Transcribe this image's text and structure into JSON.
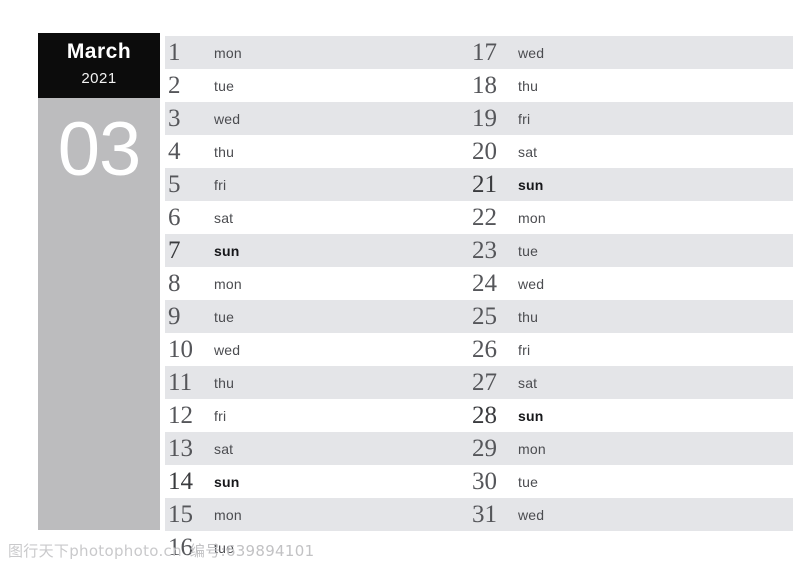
{
  "header": {
    "month_name": "March",
    "year": "2021",
    "month_number": "03"
  },
  "colors": {
    "header_background": "#0c0c0c",
    "sidebar_background": "#bcbcbe",
    "stripe_shade": "#e4e5e8",
    "stripe_blank": "#ffffff",
    "page_background": "#ffffff",
    "number_text": "#55565a",
    "weekday_text": "#4b4c50",
    "highlight_text": "#16171a",
    "watermark_text": "#c9c9cb"
  },
  "calendar": {
    "left_column": [
      {
        "date": "1",
        "weekday": "mon",
        "highlight": false,
        "shaded": true
      },
      {
        "date": "2",
        "weekday": "tue",
        "highlight": false,
        "shaded": false
      },
      {
        "date": "3",
        "weekday": "wed",
        "highlight": false,
        "shaded": true
      },
      {
        "date": "4",
        "weekday": "thu",
        "highlight": false,
        "shaded": false
      },
      {
        "date": "5",
        "weekday": "fri",
        "highlight": false,
        "shaded": true
      },
      {
        "date": "6",
        "weekday": "sat",
        "highlight": false,
        "shaded": false
      },
      {
        "date": "7",
        "weekday": "sun",
        "highlight": true,
        "shaded": true
      },
      {
        "date": "8",
        "weekday": "mon",
        "highlight": false,
        "shaded": false
      },
      {
        "date": "9",
        "weekday": "tue",
        "highlight": false,
        "shaded": true
      },
      {
        "date": "10",
        "weekday": "wed",
        "highlight": false,
        "shaded": false
      },
      {
        "date": "11",
        "weekday": "thu",
        "highlight": false,
        "shaded": true
      },
      {
        "date": "12",
        "weekday": "fri",
        "highlight": false,
        "shaded": false
      },
      {
        "date": "13",
        "weekday": "sat",
        "highlight": false,
        "shaded": true
      },
      {
        "date": "14",
        "weekday": "sun",
        "highlight": true,
        "shaded": false
      },
      {
        "date": "15",
        "weekday": "mon",
        "highlight": false,
        "shaded": true
      },
      {
        "date": "16",
        "weekday": "tue",
        "highlight": false,
        "shaded": false
      }
    ],
    "right_column": [
      {
        "date": "17",
        "weekday": "wed",
        "highlight": false,
        "shaded": true
      },
      {
        "date": "18",
        "weekday": "thu",
        "highlight": false,
        "shaded": false
      },
      {
        "date": "19",
        "weekday": "fri",
        "highlight": false,
        "shaded": true
      },
      {
        "date": "20",
        "weekday": "sat",
        "highlight": false,
        "shaded": false
      },
      {
        "date": "21",
        "weekday": "sun",
        "highlight": true,
        "shaded": true
      },
      {
        "date": "22",
        "weekday": "mon",
        "highlight": false,
        "shaded": false
      },
      {
        "date": "23",
        "weekday": "tue",
        "highlight": false,
        "shaded": true
      },
      {
        "date": "24",
        "weekday": "wed",
        "highlight": false,
        "shaded": false
      },
      {
        "date": "25",
        "weekday": "thu",
        "highlight": false,
        "shaded": true
      },
      {
        "date": "26",
        "weekday": "fri",
        "highlight": false,
        "shaded": false
      },
      {
        "date": "27",
        "weekday": "sat",
        "highlight": false,
        "shaded": true
      },
      {
        "date": "28",
        "weekday": "sun",
        "highlight": true,
        "shaded": false
      },
      {
        "date": "29",
        "weekday": "mon",
        "highlight": false,
        "shaded": true
      },
      {
        "date": "30",
        "weekday": "tue",
        "highlight": false,
        "shaded": false
      },
      {
        "date": "31",
        "weekday": "wed",
        "highlight": false,
        "shaded": true
      }
    ],
    "stripe_pattern": [
      true,
      false,
      true,
      false,
      true,
      false,
      true,
      false,
      true,
      false,
      true,
      false,
      true,
      false,
      true,
      false
    ]
  },
  "watermark": {
    "site": "图行天下photophoto.cn",
    "id_label": "编号:639894101"
  }
}
